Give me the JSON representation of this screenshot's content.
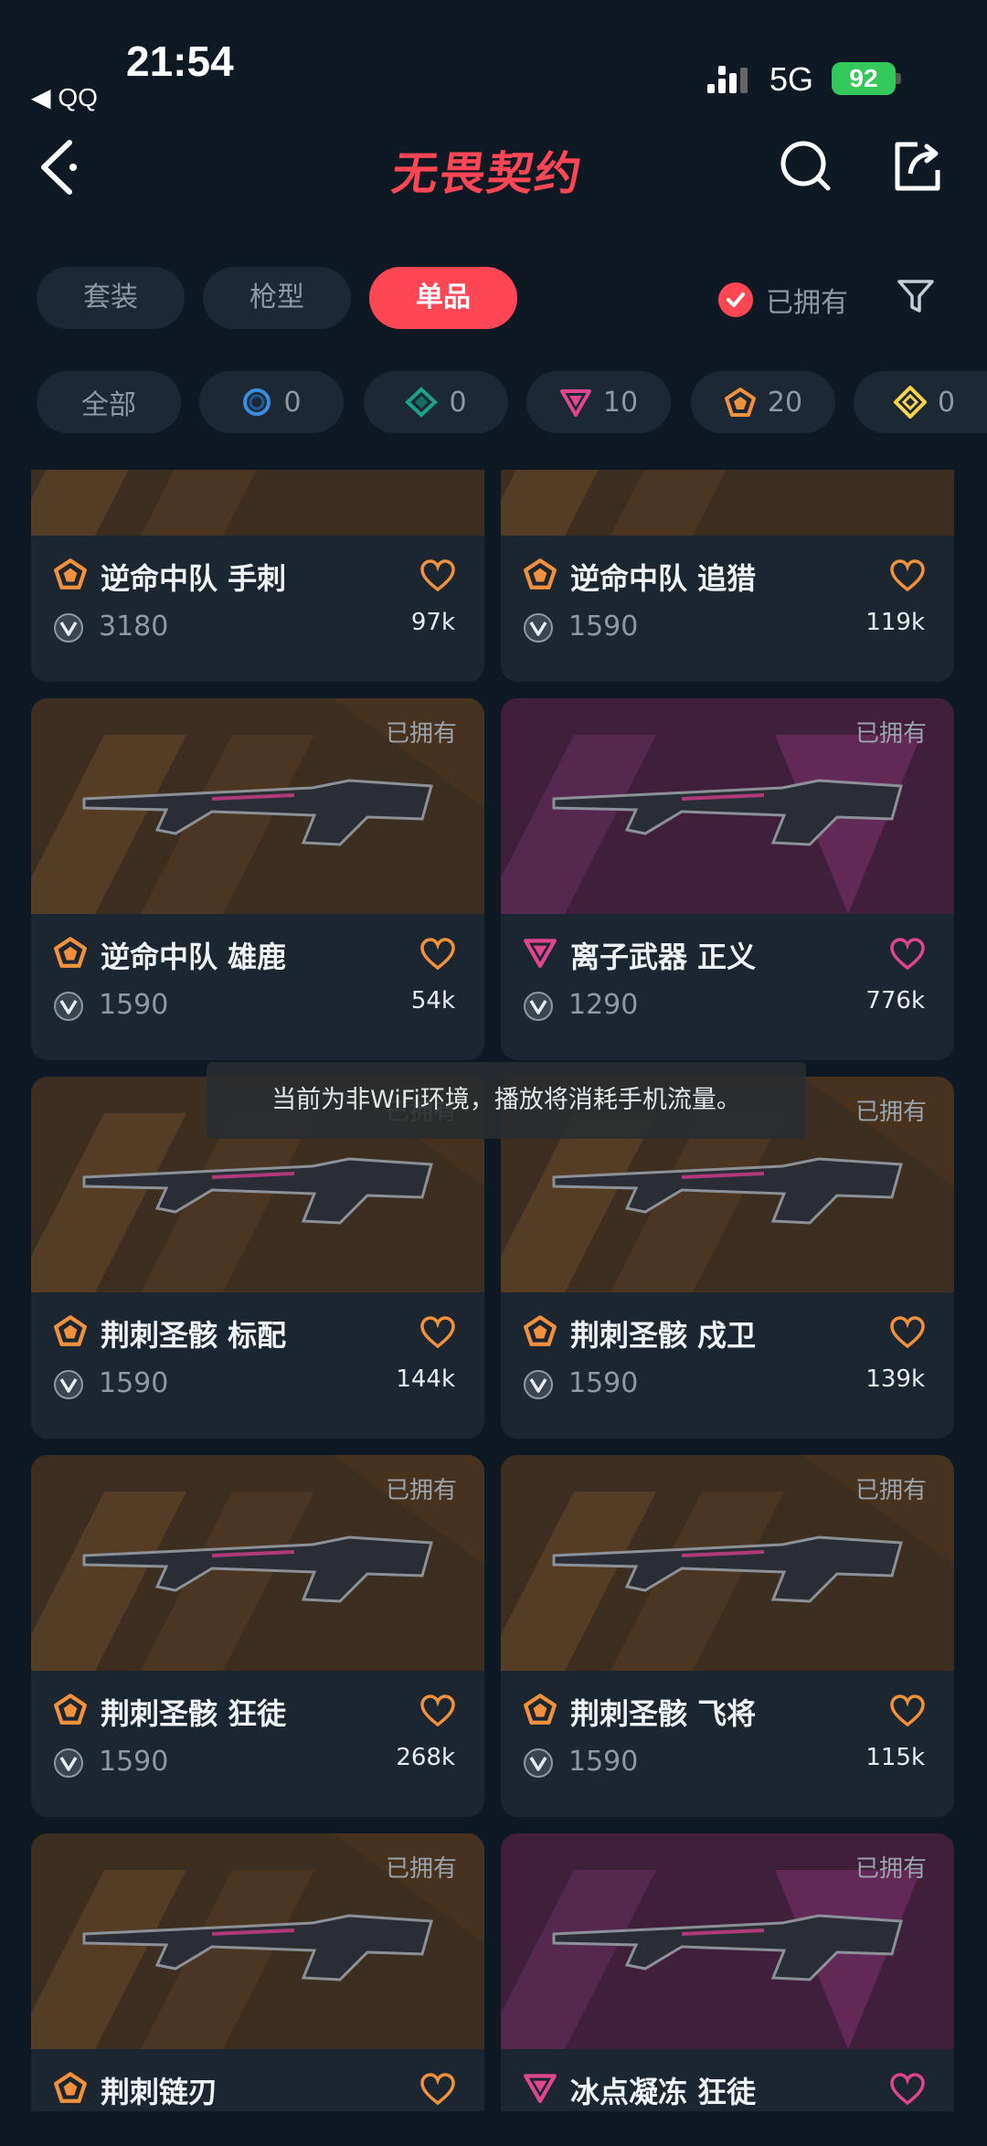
{
  "status_bar": {
    "time": "21:54",
    "back_app": "◀ QQ",
    "network": "5G",
    "battery": "92"
  },
  "header": {
    "logo": "无畏契约"
  },
  "tabs": [
    {
      "label": "套装",
      "active": false
    },
    {
      "label": "枪型",
      "active": false
    },
    {
      "label": "单品",
      "active": true
    }
  ],
  "owned_filter": {
    "label": "已拥有",
    "checked": true
  },
  "tier_chips": [
    {
      "label": "全部",
      "icon": "all"
    },
    {
      "count": "0",
      "icon": "select-tier-icon",
      "color": "#3b8ede"
    },
    {
      "count": "0",
      "icon": "deluxe-tier-icon",
      "color": "#1fa08a"
    },
    {
      "count": "10",
      "icon": "premium-tier-icon",
      "color": "#e0458f"
    },
    {
      "count": "20",
      "icon": "exclusive-tier-icon",
      "color": "#f2913d"
    },
    {
      "count": "0",
      "icon": "ultra-tier-icon",
      "color": "#f7d44c"
    }
  ],
  "toast": "当前为非WiFi环境，播放将消耗手机流量。",
  "items": [
    {
      "name": "逆命中队 手刺",
      "price": "3180",
      "likes": "97k",
      "owned": false,
      "tier": "exclusive",
      "bg": "orange"
    },
    {
      "name": "逆命中队 追猎",
      "price": "1590",
      "likes": "119k",
      "owned": false,
      "tier": "exclusive",
      "bg": "orange"
    },
    {
      "name": "逆命中队 雄鹿",
      "price": "1590",
      "likes": "54k",
      "owned": true,
      "owned_label": "已拥有",
      "tier": "exclusive",
      "bg": "orange"
    },
    {
      "name": "离子武器 正义",
      "price": "1290",
      "likes": "776k",
      "owned": true,
      "owned_label": "已拥有",
      "tier": "premium",
      "bg": "purple"
    },
    {
      "name": "荆刺圣骸 标配",
      "price": "1590",
      "likes": "144k",
      "owned": true,
      "owned_label": "已拥有",
      "tier": "exclusive",
      "bg": "orange"
    },
    {
      "name": "荆刺圣骸 戍卫",
      "price": "1590",
      "likes": "139k",
      "owned": true,
      "owned_label": "已拥有",
      "tier": "exclusive",
      "bg": "orange"
    },
    {
      "name": "荆刺圣骸 狂徒",
      "price": "1590",
      "likes": "268k",
      "owned": true,
      "owned_label": "已拥有",
      "tier": "exclusive",
      "bg": "orange"
    },
    {
      "name": "荆刺圣骸 飞将",
      "price": "1590",
      "likes": "115k",
      "owned": true,
      "owned_label": "已拥有",
      "tier": "exclusive",
      "bg": "orange"
    },
    {
      "name": "荆刺链刃",
      "price": "",
      "likes": "",
      "owned": true,
      "owned_label": "已拥有",
      "tier": "exclusive",
      "bg": "orange"
    },
    {
      "name": "冰点凝冻 狂徒",
      "price": "",
      "likes": "",
      "owned": true,
      "owned_label": "已拥有",
      "tier": "premium",
      "bg": "purple"
    }
  ]
}
